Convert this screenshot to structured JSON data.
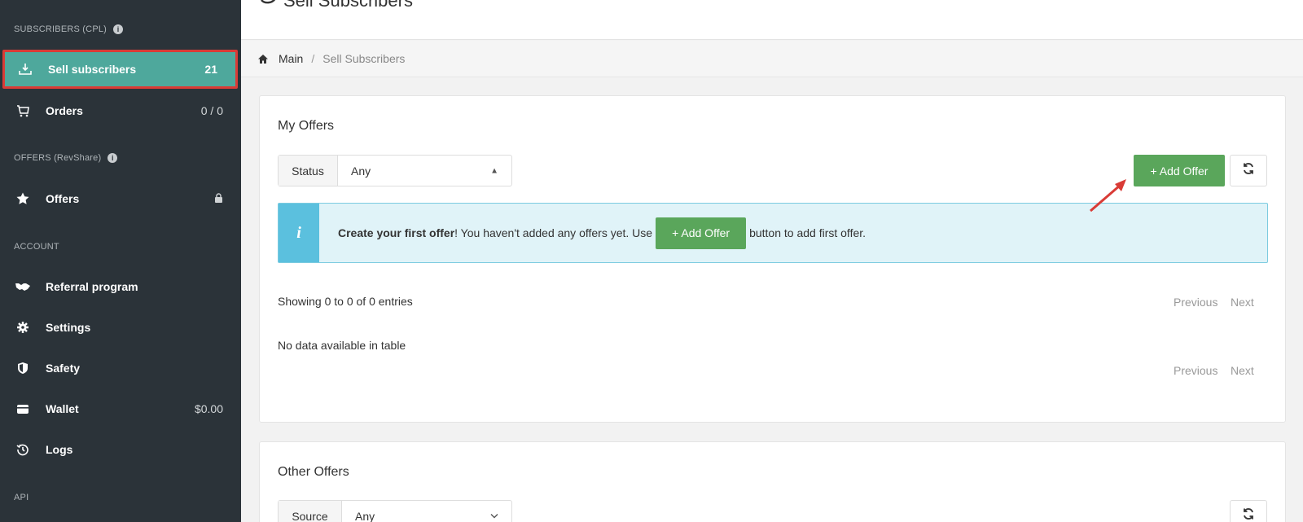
{
  "sidebar": {
    "sections": {
      "subscribers": "SUBSCRIBERS (CPL)",
      "offers": "OFFERS (RevShare)",
      "account": "ACCOUNT",
      "api": "API"
    },
    "items": [
      {
        "label": "Sell subscribers",
        "value": "21",
        "icon": "download-tray-icon"
      },
      {
        "label": "Orders",
        "value": "0 / 0",
        "icon": "cart-icon"
      },
      {
        "label": "Offers",
        "value": "",
        "icon": "star-icon"
      },
      {
        "label": "Referral program",
        "value": "",
        "icon": "handshake-icon"
      },
      {
        "label": "Settings",
        "value": "",
        "icon": "gear-icon"
      },
      {
        "label": "Safety",
        "value": "",
        "icon": "shield-icon"
      },
      {
        "label": "Wallet",
        "value": "$0.00",
        "icon": "wallet-icon"
      },
      {
        "label": "Logs",
        "value": "",
        "icon": "history-icon"
      }
    ]
  },
  "header": {
    "title": "Sell Subscribers"
  },
  "breadcrumb": {
    "main": "Main",
    "separator": "/",
    "current": "Sell Subscribers"
  },
  "my_offers": {
    "title": "My Offers",
    "filter_label": "Status",
    "filter_value": "Any",
    "add_button": "+ Add Offer",
    "alert": {
      "bold": "Create your first offer",
      "text1": "! You haven't added any offers yet. Use",
      "button": "+ Add Offer",
      "text2": "button to add first offer."
    },
    "showing": "Showing 0 to 0 of 0 entries",
    "empty": "No data available in table",
    "previous": "Previous",
    "next": "Next"
  },
  "other_offers": {
    "title": "Other Offers",
    "filter_label": "Source",
    "filter_value": "Any"
  },
  "colors": {
    "sidebar_bg": "#2b3339",
    "active_bg": "#4ea89c",
    "highlight_border": "#d93b36",
    "green_button": "#5aa65b",
    "info_accent": "#5bc0de"
  }
}
